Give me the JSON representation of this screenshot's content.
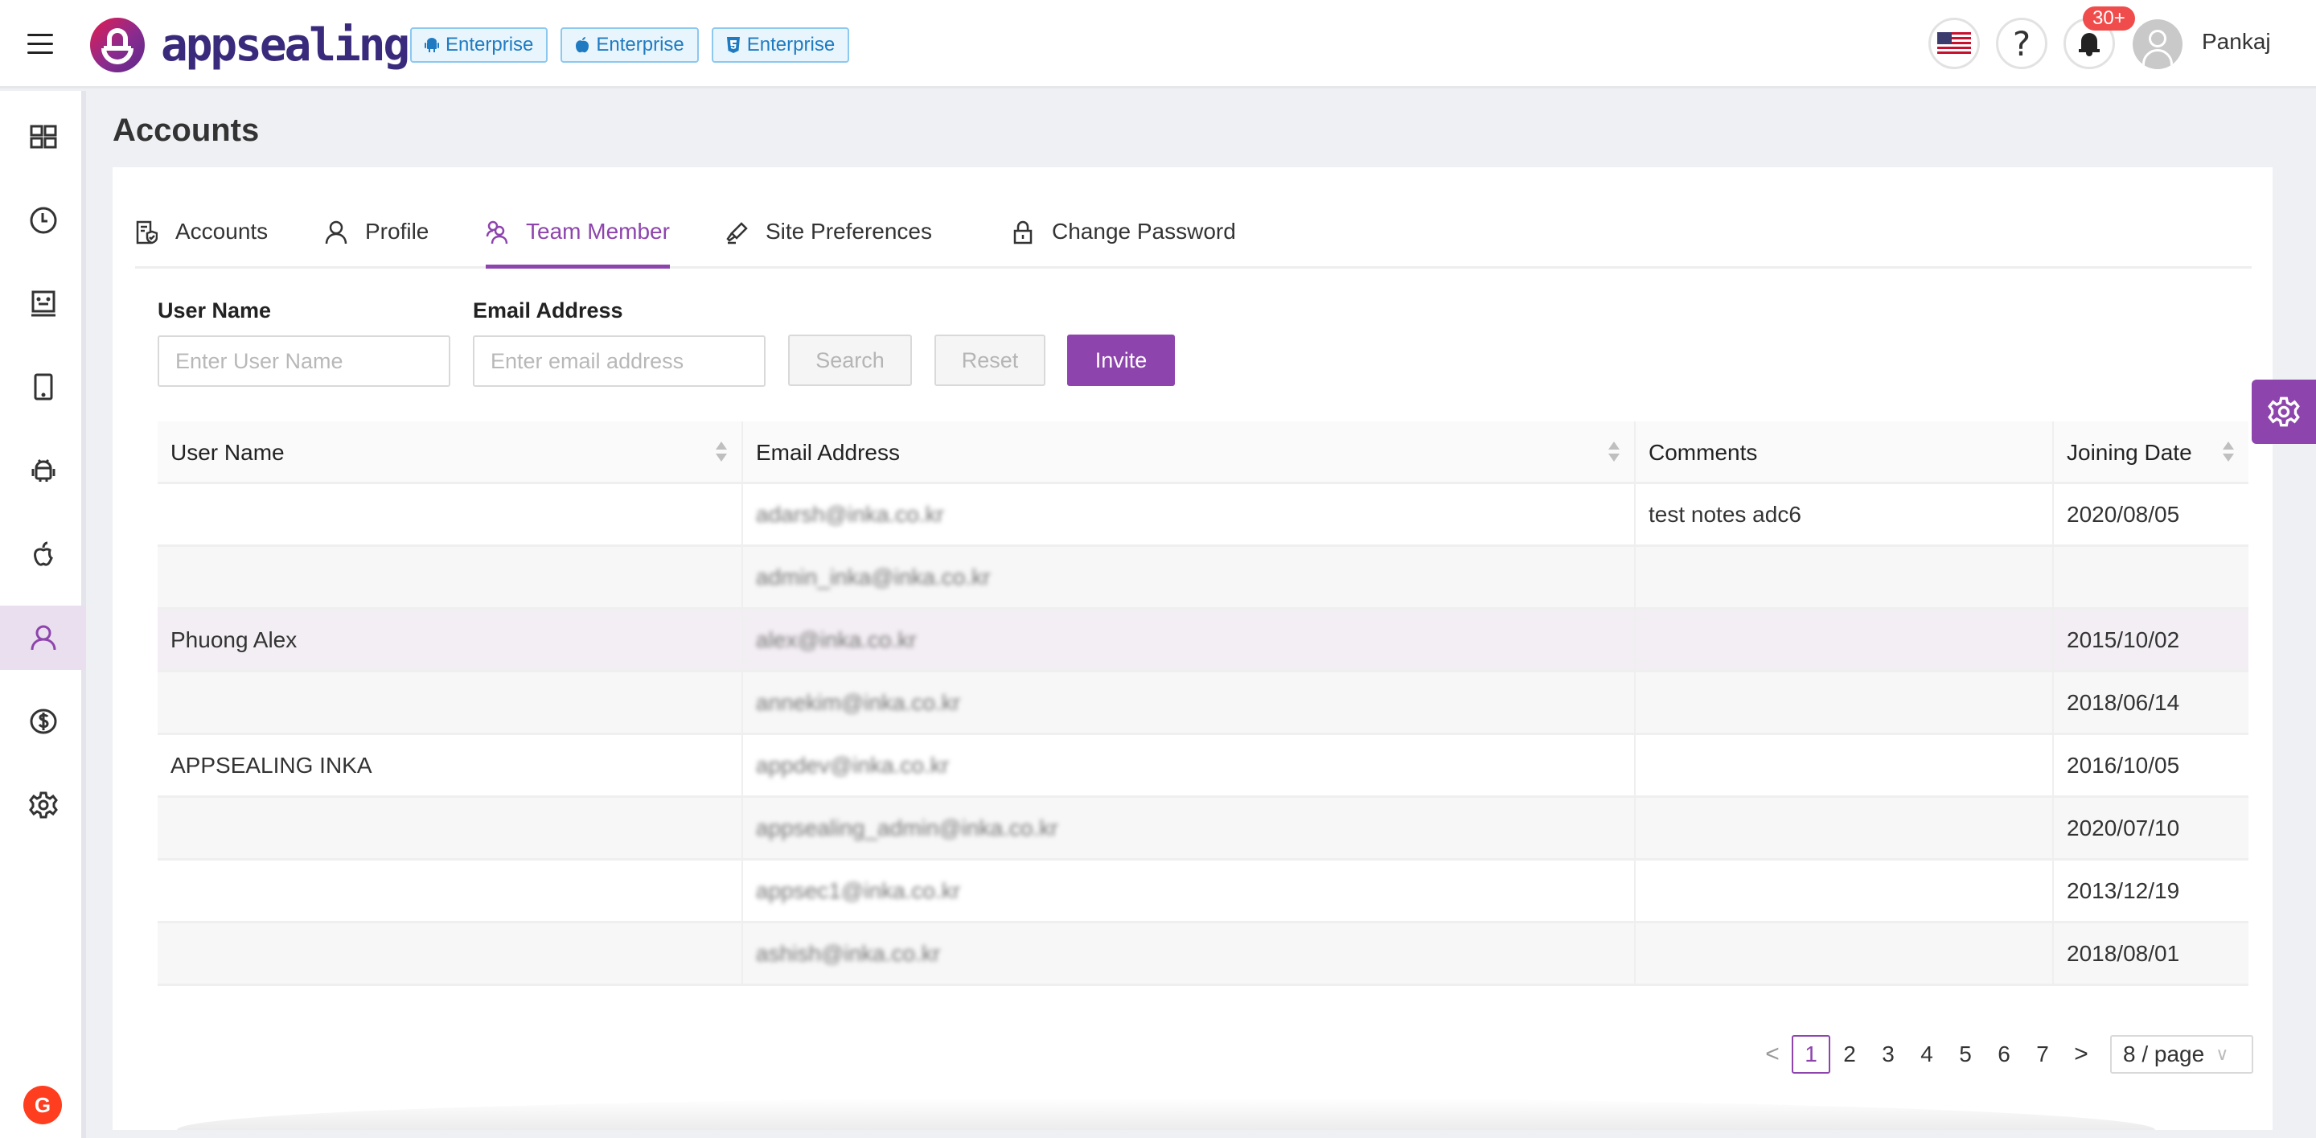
{
  "header": {
    "brand": "appsealing",
    "badges": [
      {
        "icon": "android-icon",
        "label": "Enterprise"
      },
      {
        "icon": "apple-icon",
        "label": "Enterprise"
      },
      {
        "icon": "html5-icon",
        "label": "Enterprise"
      }
    ],
    "help_glyph": "?",
    "notification_count": "30+",
    "user_name": "Pankaj"
  },
  "sidebar": {
    "items": [
      {
        "name": "dashboard",
        "icon": "grid-icon",
        "active": false
      },
      {
        "name": "history",
        "icon": "clock-icon",
        "active": false
      },
      {
        "name": "monitor",
        "icon": "monitor-icon",
        "active": false
      },
      {
        "name": "mobile",
        "icon": "tablet-icon",
        "active": false
      },
      {
        "name": "android",
        "icon": "android-icon",
        "active": false
      },
      {
        "name": "ios",
        "icon": "apple-icon",
        "active": false
      },
      {
        "name": "accounts",
        "icon": "user-icon",
        "active": true
      },
      {
        "name": "billing",
        "icon": "dollar-icon",
        "active": false
      },
      {
        "name": "settings",
        "icon": "gear-icon",
        "active": false
      }
    ],
    "g2_label": "G"
  },
  "page": {
    "title": "Accounts"
  },
  "tabs": [
    {
      "label": "Accounts",
      "icon": "document-shield-icon",
      "active": false
    },
    {
      "label": "Profile",
      "icon": "user-icon",
      "active": false
    },
    {
      "label": "Team Member",
      "icon": "users-icon",
      "active": true
    },
    {
      "label": "Site Preferences",
      "icon": "brush-icon",
      "active": false
    },
    {
      "label": "Change Password",
      "icon": "lock-icon",
      "active": false
    }
  ],
  "filters": {
    "user_name_label": "User Name",
    "user_name_placeholder": "Enter User Name",
    "user_name_value": "",
    "email_label": "Email Address",
    "email_placeholder": "Enter email address",
    "email_value": "",
    "search_label": "Search",
    "reset_label": "Reset",
    "invite_label": "Invite"
  },
  "table": {
    "columns": [
      "User Name",
      "Email Address",
      "Comments",
      "Joining Date"
    ],
    "rows": [
      {
        "user_name": "",
        "email": "adarsh@inka.co.kr",
        "comments": "test notes adc6",
        "joining_date": "2020/08/05"
      },
      {
        "user_name": "",
        "email": "admin_inka@inka.co.kr",
        "comments": "",
        "joining_date": ""
      },
      {
        "user_name": "Phuong Alex",
        "email": "alex@inka.co.kr",
        "comments": "",
        "joining_date": "2015/10/02"
      },
      {
        "user_name": "",
        "email": "annekim@inka.co.kr",
        "comments": "",
        "joining_date": "2018/06/14"
      },
      {
        "user_name": "APPSEALING INKA",
        "email": "appdev@inka.co.kr",
        "comments": "",
        "joining_date": "2016/10/05"
      },
      {
        "user_name": "",
        "email": "appsealing_admin@inka.co.kr",
        "comments": "",
        "joining_date": "2020/07/10"
      },
      {
        "user_name": "",
        "email": "appsec1@inka.co.kr",
        "comments": "",
        "joining_date": "2013/12/19"
      },
      {
        "user_name": "",
        "email": "ashish@inka.co.kr",
        "comments": "",
        "joining_date": "2018/08/01"
      }
    ]
  },
  "pagination": {
    "prev": "<",
    "next": ">",
    "pages": [
      "1",
      "2",
      "3",
      "4",
      "5",
      "6",
      "7"
    ],
    "current": "1",
    "page_size": "8 / page"
  },
  "colors": {
    "accent": "#8e44ad",
    "badge_text": "#1f7bc1",
    "notification": "#f04c4c",
    "brand_text": "#3a2a7c"
  }
}
